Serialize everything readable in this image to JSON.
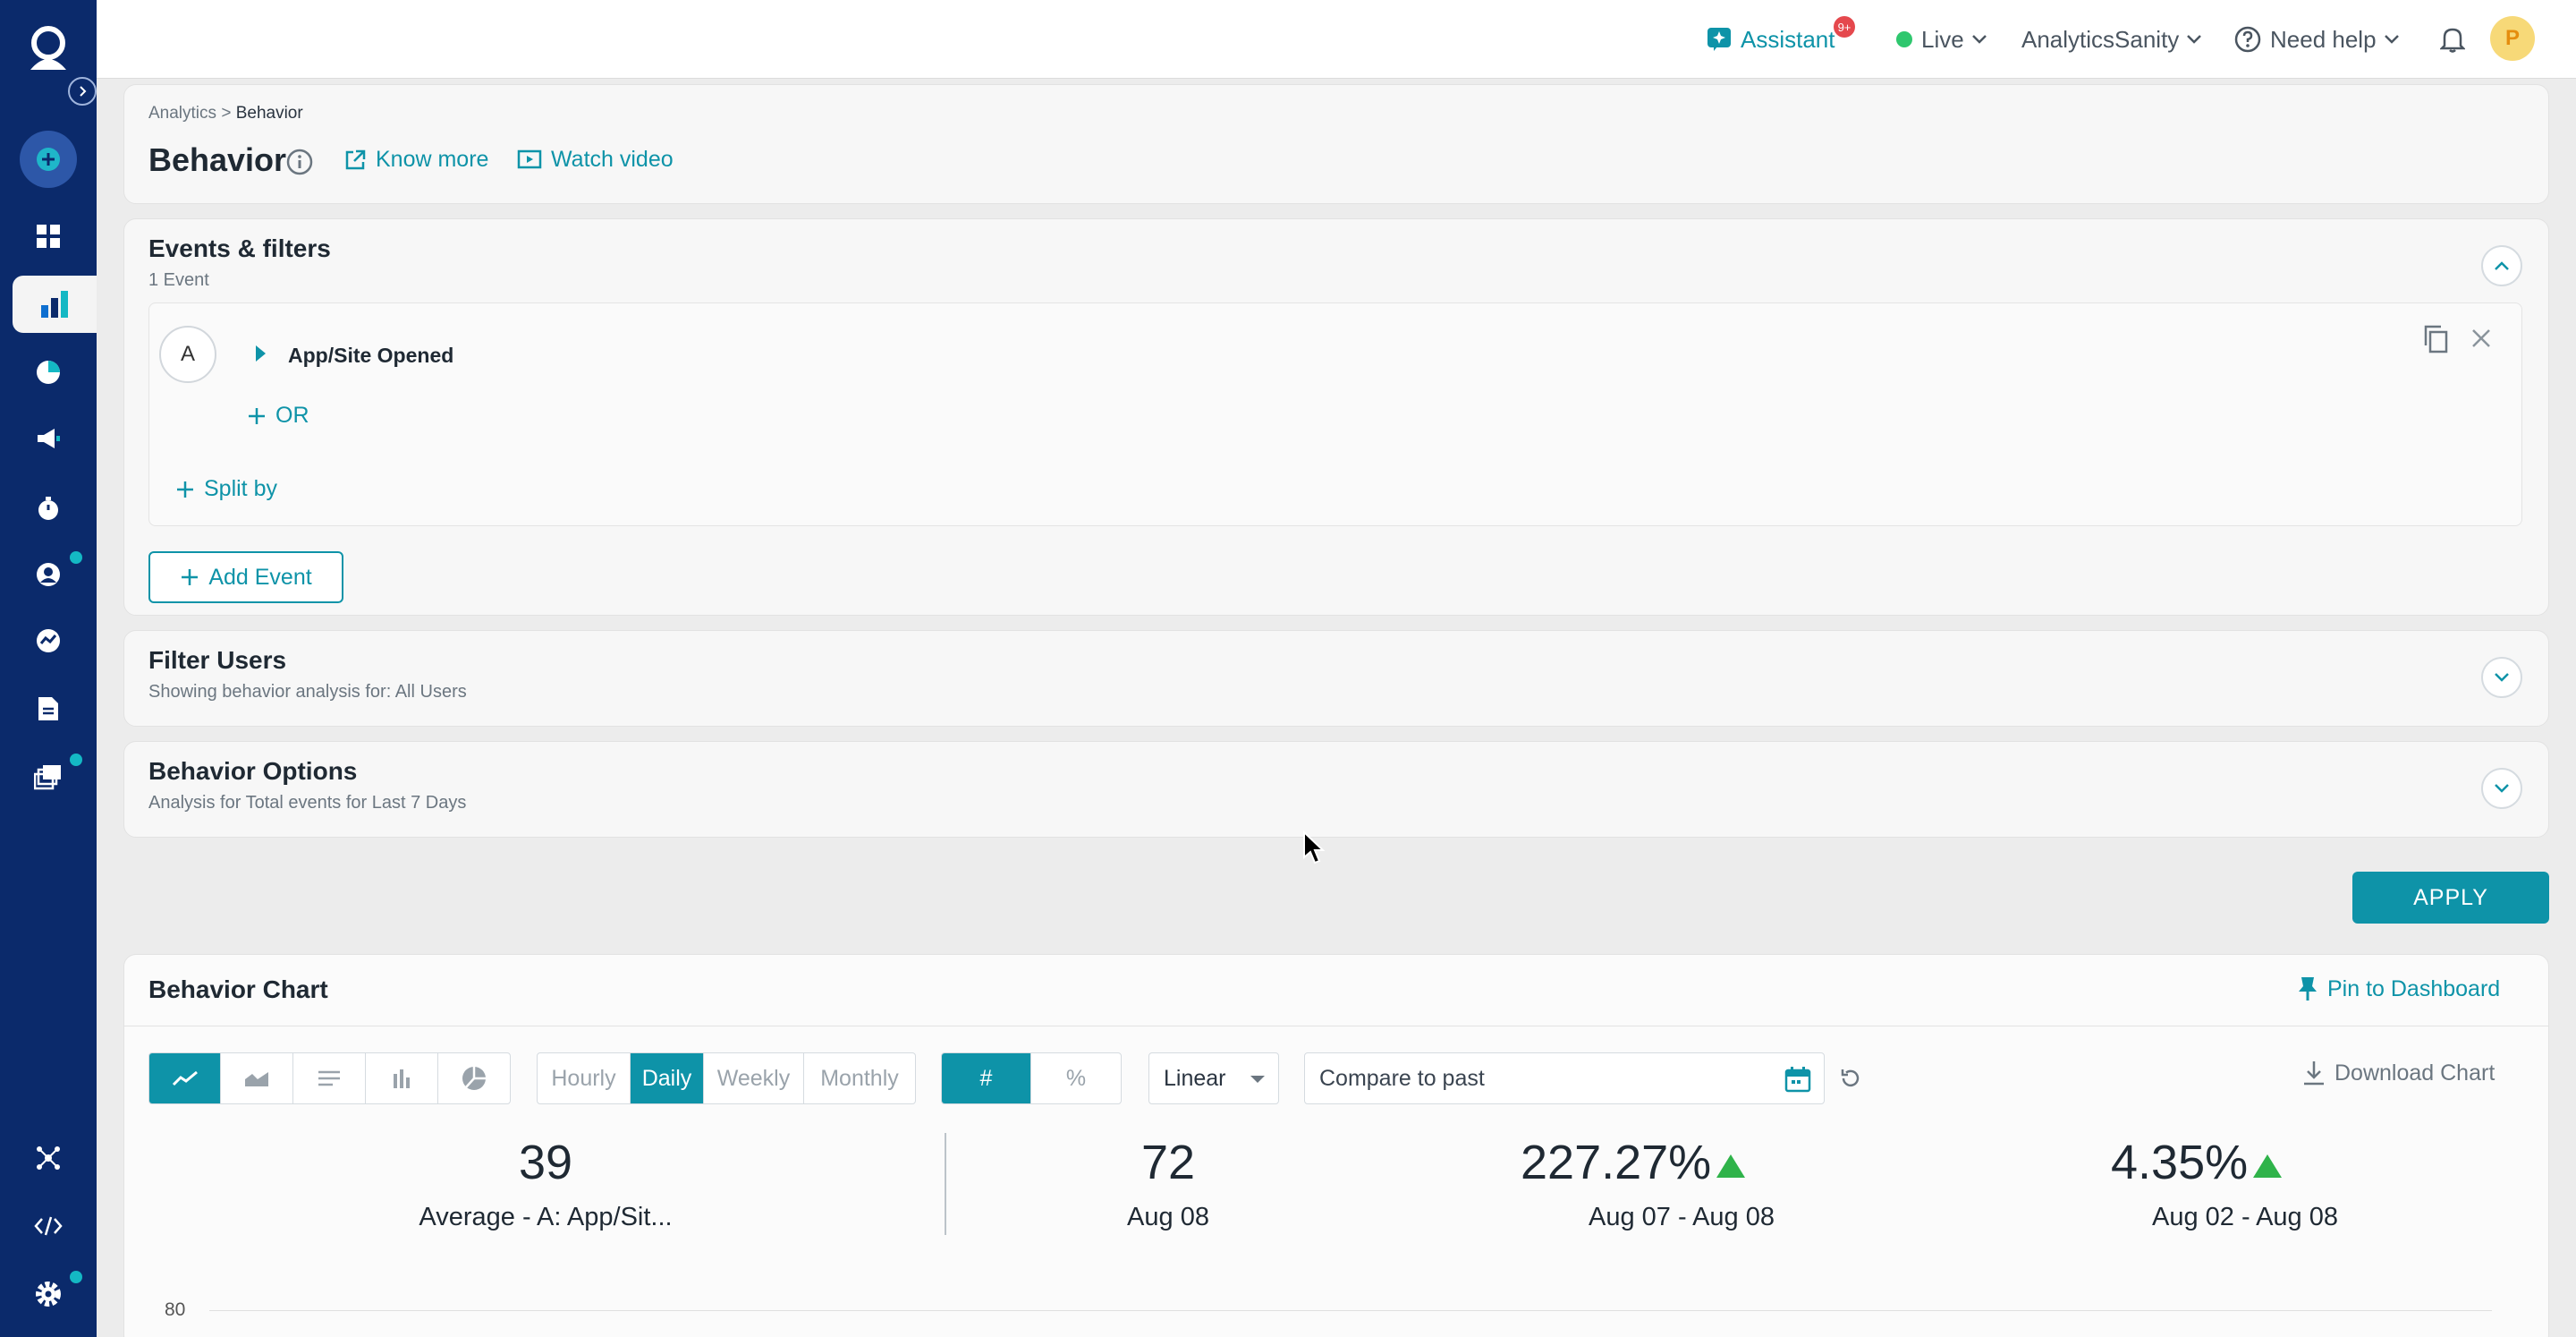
{
  "topbar": {
    "assistant": "Assistant",
    "assistant_badge": "9+",
    "env": "Live",
    "project": "AnalyticsSanity",
    "help": "Need help",
    "avatar_initial": "P"
  },
  "breadcrumb": {
    "parent": "Analytics",
    "sep": ">",
    "current": "Behavior"
  },
  "header": {
    "title": "Behavior",
    "know_more": "Know more",
    "watch_video": "Watch video"
  },
  "events": {
    "title": "Events & filters",
    "subtitle": "1 Event",
    "letter": "A",
    "event_name": "App/Site Opened",
    "or_label": "OR",
    "split_label": "Split by",
    "add_event": "Add Event"
  },
  "filter_users": {
    "title": "Filter Users",
    "subtitle": "Showing behavior analysis for: All Users"
  },
  "behavior_options": {
    "title": "Behavior Options",
    "subtitle": "Analysis for Total events for Last 7 Days"
  },
  "apply": "APPLY",
  "chart": {
    "title": "Behavior Chart",
    "pin": "Pin to Dashboard",
    "granularity": [
      "Hourly",
      "Daily",
      "Weekly",
      "Monthly"
    ],
    "selected_granularity": "Daily",
    "value_mode": [
      "#",
      "%"
    ],
    "scale": "Linear",
    "compare_placeholder": "Compare to past",
    "download": "Download Chart",
    "metrics": [
      {
        "value": "39",
        "label": "Average - A: App/Sit..."
      },
      {
        "value": "72",
        "label": "Aug 08"
      },
      {
        "value": "227.27%",
        "label": "Aug 07 - Aug 08",
        "trend": "up"
      },
      {
        "value": "4.35%",
        "label": "Aug 02 - Aug 08",
        "trend": "up"
      }
    ],
    "y_tick_top": "80"
  },
  "colors": {
    "accent": "#0e93a8",
    "sidebar": "#0b2a6b",
    "up": "#2fb34a"
  }
}
